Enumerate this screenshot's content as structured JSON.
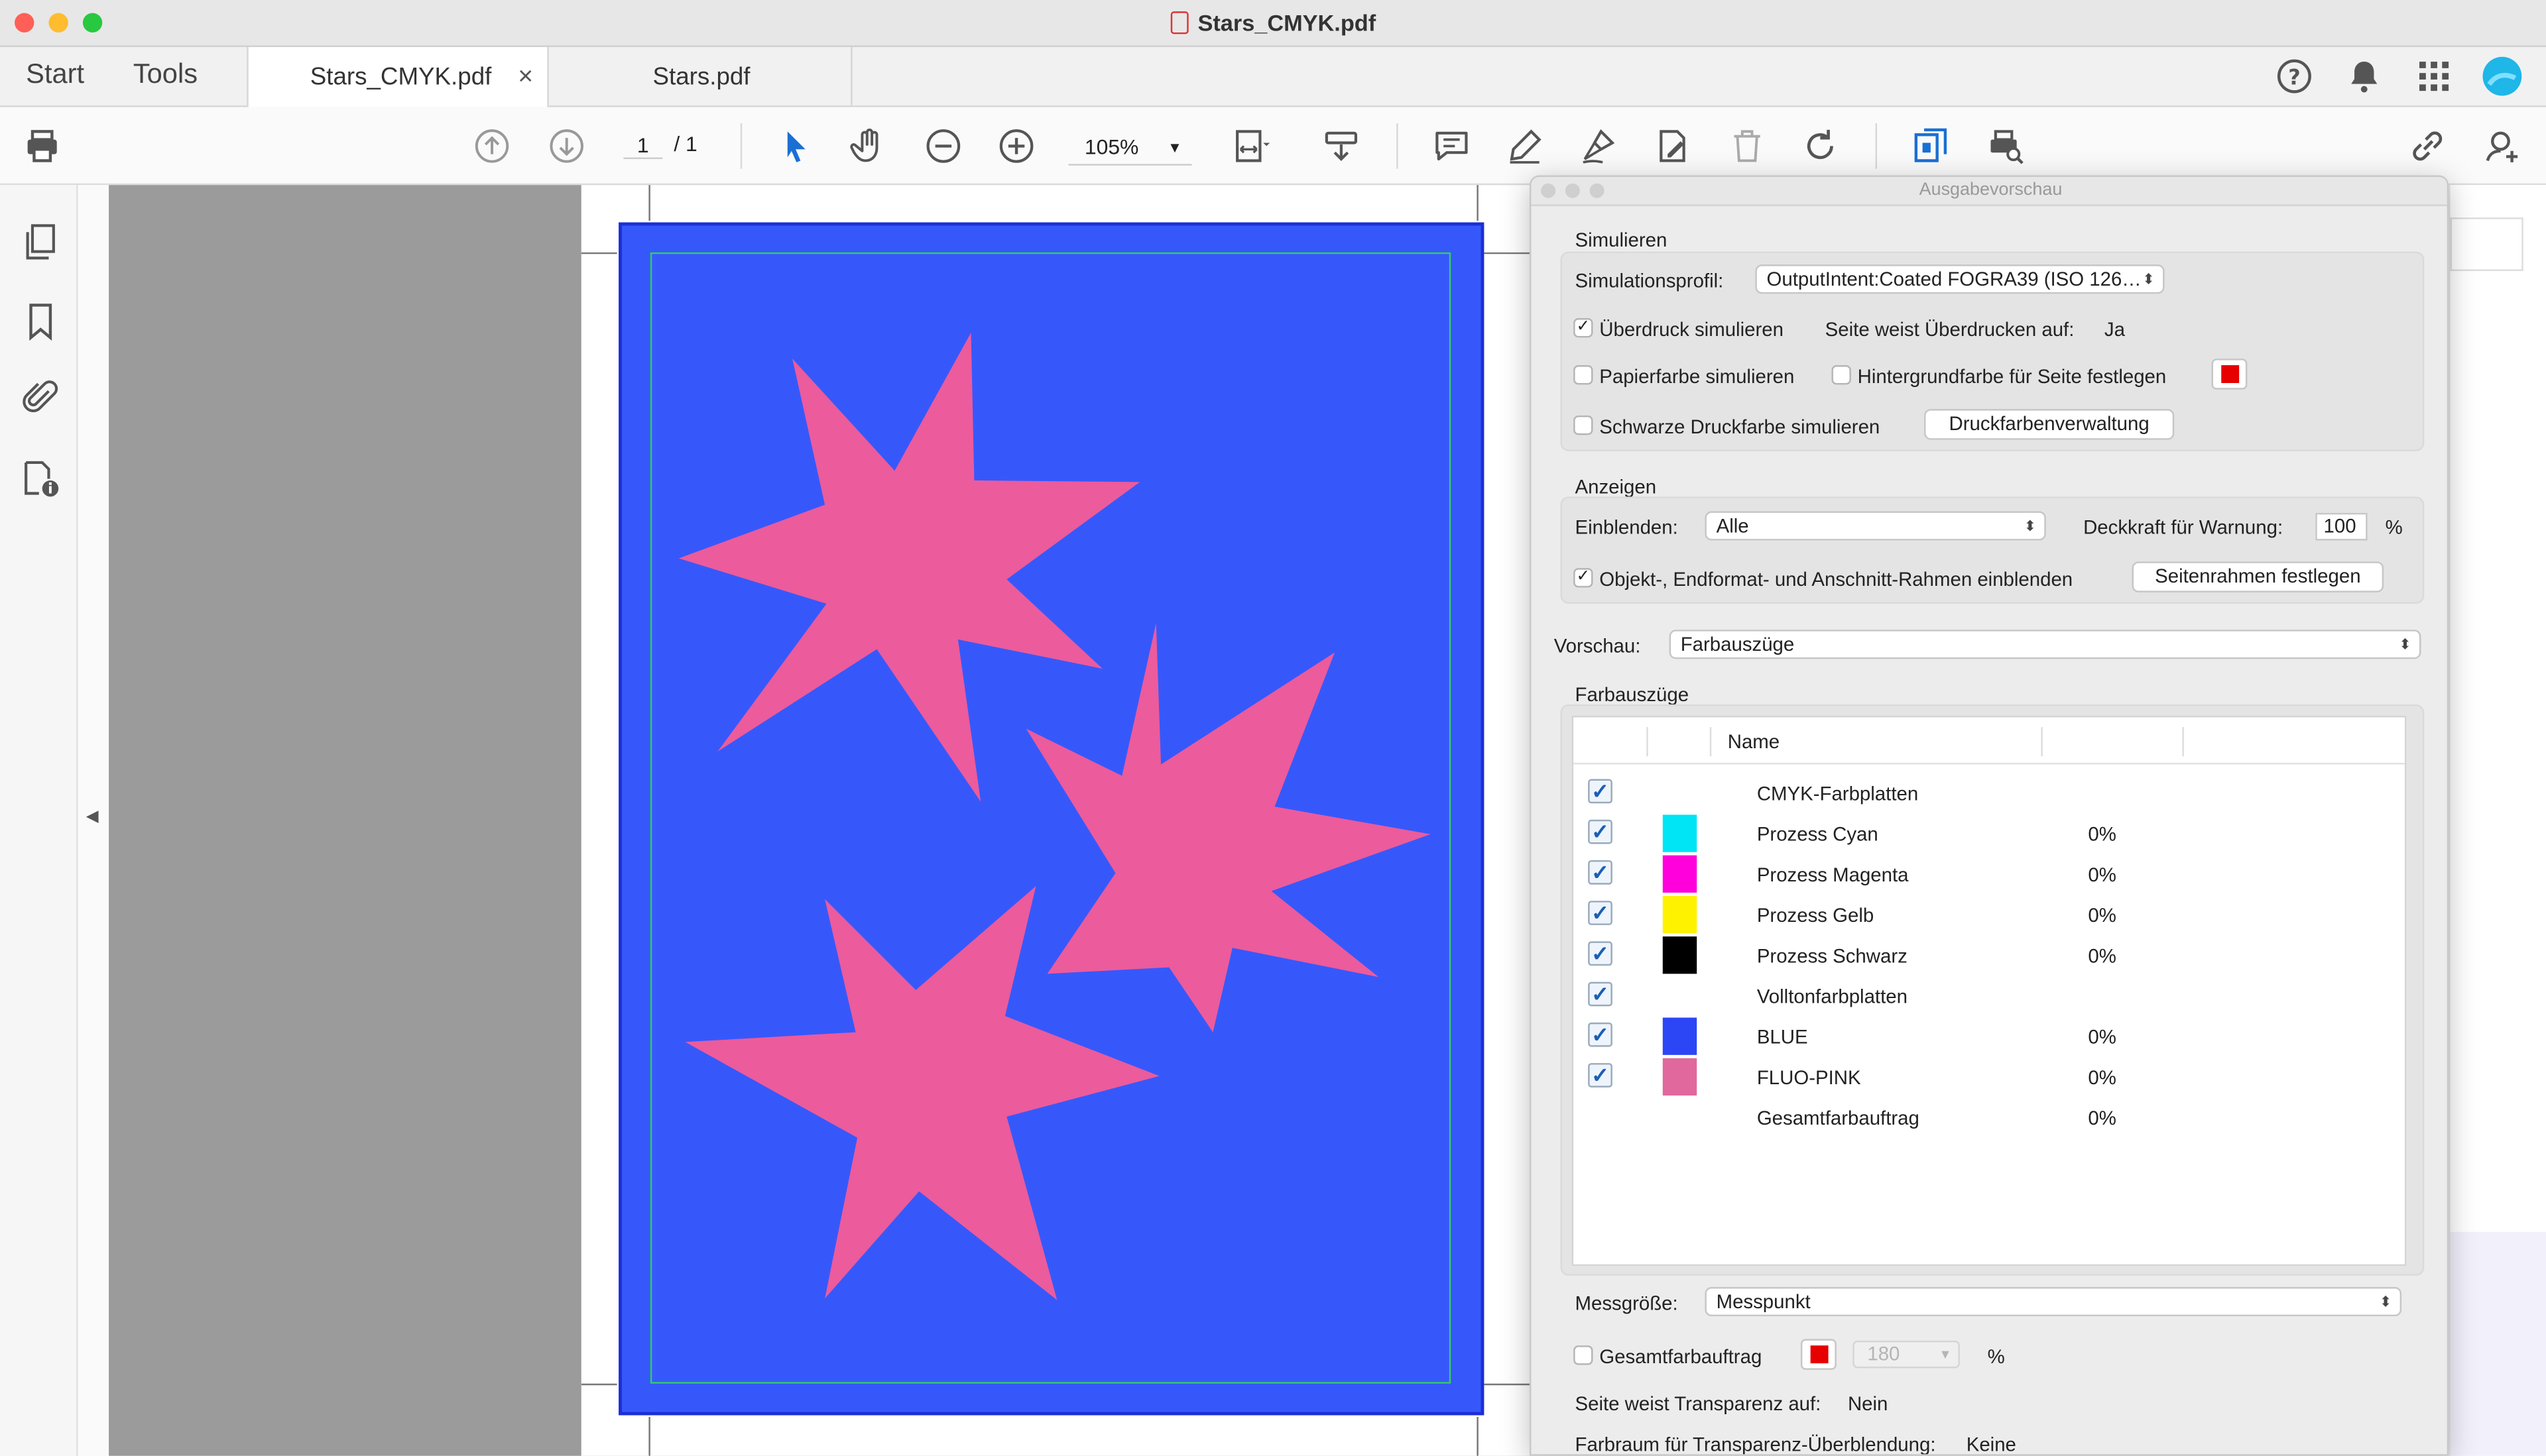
{
  "window": {
    "title": "Stars_CMYK.pdf"
  },
  "nav": {
    "start": "Start",
    "tools": "Tools"
  },
  "tabs": [
    {
      "label": "Stars_CMYK.pdf",
      "close": "×"
    },
    {
      "label": "Stars.pdf"
    }
  ],
  "toolbar": {
    "page_current": "1",
    "page_total": "/ 1",
    "zoom": "105%"
  },
  "panel": {
    "title": "Ausgabevorschau",
    "simulate": {
      "heading": "Simulieren",
      "profile_label": "Simulationsprofil:",
      "profile_value": "OutputIntent:Coated FOGRA39 (ISO 126…",
      "overprint_label": "Überdruck simulieren",
      "overprint_checked": true,
      "page_overprint_label": "Seite weist Überdrucken auf:",
      "page_overprint_value": "Ja",
      "paper_color_label": "Papierfarbe simulieren",
      "bg_color_label": "Hintergrundfarbe für Seite festlegen",
      "bg_swatch_color": "#e60000",
      "black_ink_label": "Schwarze Druckfarbe simulieren",
      "ink_manager_button": "Druckfarbenverwaltung"
    },
    "show": {
      "heading": "Anzeigen",
      "show_label": "Einblenden:",
      "show_value": "Alle",
      "opacity_label": "Deckkraft für Warnung:",
      "opacity_value": "100",
      "opacity_unit": "%",
      "frames_label": "Objekt-, Endformat- und Anschnitt-Rahmen einblenden",
      "frames_checked": true,
      "set_frames_button": "Seitenrahmen festlegen"
    },
    "preview": {
      "label": "Vorschau:",
      "value": "Farbauszüge"
    },
    "separations": {
      "heading": "Farbauszüge",
      "column_name": "Name",
      "rows": [
        {
          "name": "CMYK-Farbplatten",
          "pct": "",
          "color": ""
        },
        {
          "name": "Prozess Cyan",
          "pct": "0%",
          "color": "#00e5f5"
        },
        {
          "name": "Prozess Magenta",
          "pct": "0%",
          "color": "#ff00dd"
        },
        {
          "name": "Prozess Gelb",
          "pct": "0%",
          "color": "#fff200"
        },
        {
          "name": "Prozess Schwarz",
          "pct": "0%",
          "color": "#000000"
        },
        {
          "name": "Volltonfarbplatten",
          "pct": "",
          "color": ""
        },
        {
          "name": "BLUE",
          "pct": "0%",
          "color": "#2c46f5"
        },
        {
          "name": "FLUO-PINK",
          "pct": "0%",
          "color": "#e0689c"
        },
        {
          "name": "Gesamtfarbauftrag",
          "pct": "0%",
          "color": ""
        }
      ]
    },
    "sample": {
      "label": "Messgröße:",
      "value": "Messpunkt"
    },
    "total_coverage": {
      "label": "Gesamtfarbauftrag",
      "swatch_color": "#e60000",
      "value": "180",
      "unit": "%"
    },
    "transparency": {
      "label": "Seite weist Transparenz auf:",
      "value": "Nein"
    },
    "blend_space": {
      "label": "Farbraum für Transparenz-Überblendung:",
      "value": "Keine"
    }
  },
  "document": {
    "page_color": "#3658fb",
    "star_color": "#ec5b9c",
    "trim_color": "#33cc66"
  }
}
